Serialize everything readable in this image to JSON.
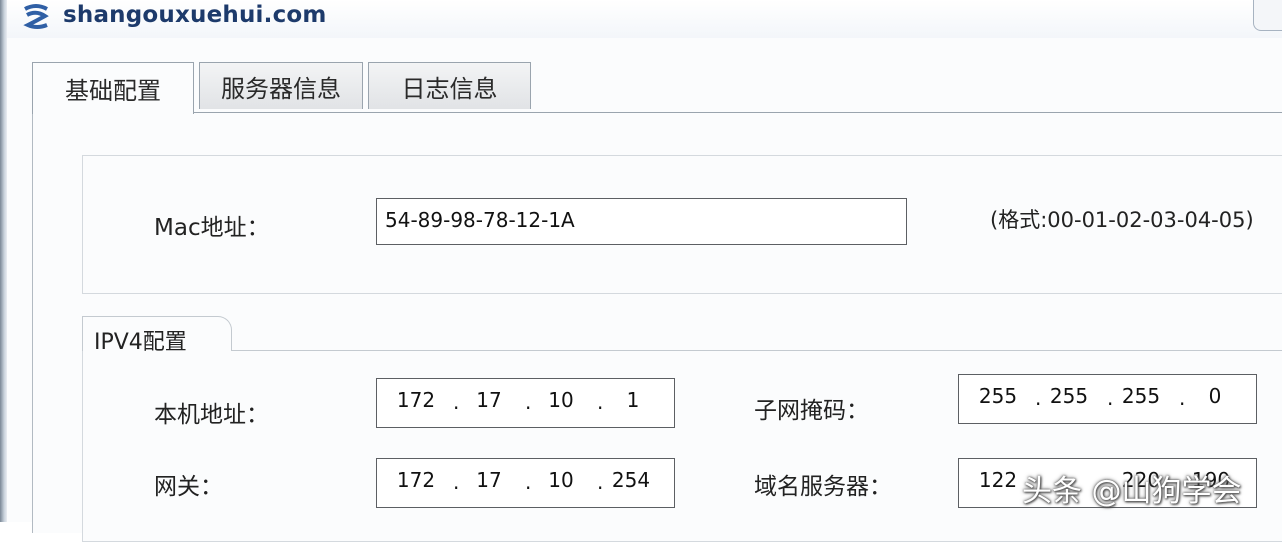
{
  "window": {
    "title": "shangouxuehui.com"
  },
  "tabs": [
    {
      "label": "基础配置",
      "active": true
    },
    {
      "label": "服务器信息",
      "active": false
    },
    {
      "label": "日志信息",
      "active": false
    }
  ],
  "mac": {
    "label": "Mac地址：",
    "value": "54-89-98-78-12-1A",
    "format_hint": "(格式:00-01-02-03-04-05)"
  },
  "ipv4": {
    "title": "IPV4配置",
    "local_address": {
      "label": "本机地址：",
      "octets": [
        "172",
        "17",
        "10",
        "1"
      ]
    },
    "subnet_mask": {
      "label": "子网掩码：",
      "octets": [
        "255",
        "255",
        "255",
        "0"
      ]
    },
    "gateway": {
      "label": "网关：",
      "octets": [
        "172",
        "17",
        "10",
        "254"
      ]
    },
    "dns_server": {
      "label": "域名服务器：",
      "octets": [
        "122",
        "",
        "220",
        "190"
      ]
    }
  },
  "ip_separator": ".",
  "watermark": "头条 @山狗学会",
  "icons": {
    "app": "app-icon"
  },
  "colors": {
    "title_text": "#1d3a6b",
    "border": "#9aa4ae",
    "field_border": "#5c5f63"
  }
}
